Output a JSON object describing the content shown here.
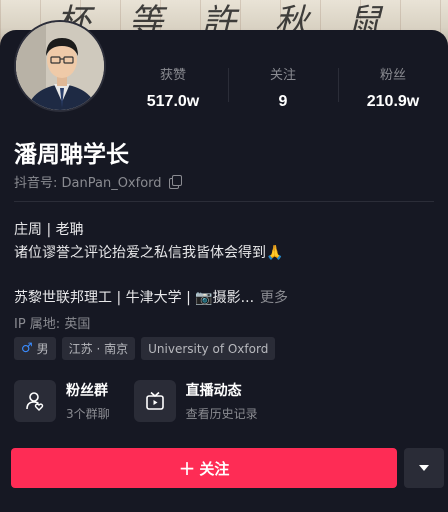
{
  "banner": {
    "ink_text": "杯 等 許 秋 鼠 工 上"
  },
  "stats": [
    {
      "label": "获赞",
      "value": "517.0w"
    },
    {
      "label": "关注",
      "value": "9"
    },
    {
      "label": "粉丝",
      "value": "210.9w"
    }
  ],
  "profile": {
    "name": "潘周聃学长",
    "douyin_id": "抖音号: DanPan_Oxford",
    "bio_line1": "庄周 | 老聃",
    "bio_line2": "诸位谬誉之评论抬爱之私信我皆体会得到",
    "bio_emoji": "🙏",
    "education": "苏黎世联邦理工 | 牛津大学 | 📷摄影...",
    "more": "更多",
    "ip": "IP 属地:  英国"
  },
  "tags": [
    {
      "icon": "male-icon",
      "symbol": "♂",
      "label": "男"
    },
    {
      "label": "江苏 · 南京"
    },
    {
      "label": "University of Oxford"
    }
  ],
  "shortcuts": [
    {
      "icon": "fan-group-icon",
      "title": "粉丝群",
      "sub": "3个群聊"
    },
    {
      "icon": "live-icon",
      "title": "直播动态",
      "sub": "查看历史记录"
    }
  ],
  "actions": {
    "follow_plus": "+",
    "follow_label": "关注"
  },
  "colors": {
    "background": "#161823",
    "accent": "#fe2c55",
    "muted": "#8a8b91",
    "chip": "#2a2c37"
  }
}
